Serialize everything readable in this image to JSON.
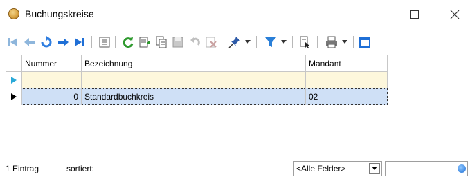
{
  "window": {
    "title": "Buchungskreise",
    "icon": "globe-icon"
  },
  "toolbar": {
    "buttons": [
      "first-record-icon",
      "previous-record-icon",
      "refresh-record-icon",
      "next-record-icon",
      "last-record-icon",
      "form-view-icon",
      "reload-icon",
      "new-record-icon",
      "copy-record-icon",
      "save-record-icon",
      "undo-icon",
      "delete-record-icon",
      "pin-icon",
      "filter-icon",
      "export-icon",
      "print-icon",
      "layout-icon"
    ]
  },
  "grid": {
    "columns": [
      "Nummer",
      "Bezeichnung",
      "Mandant"
    ],
    "rows": [
      {
        "nummer": "0",
        "bezeichnung": "Standardbuchkreis",
        "mandant": "02"
      }
    ],
    "colors": {
      "new_row": "#fdf7dc",
      "selected_row": "#cfe0f6"
    }
  },
  "statusbar": {
    "count": "1 Eintrag",
    "sort": "sortiert:",
    "field_select": "<Alle Felder>",
    "search_value": ""
  }
}
